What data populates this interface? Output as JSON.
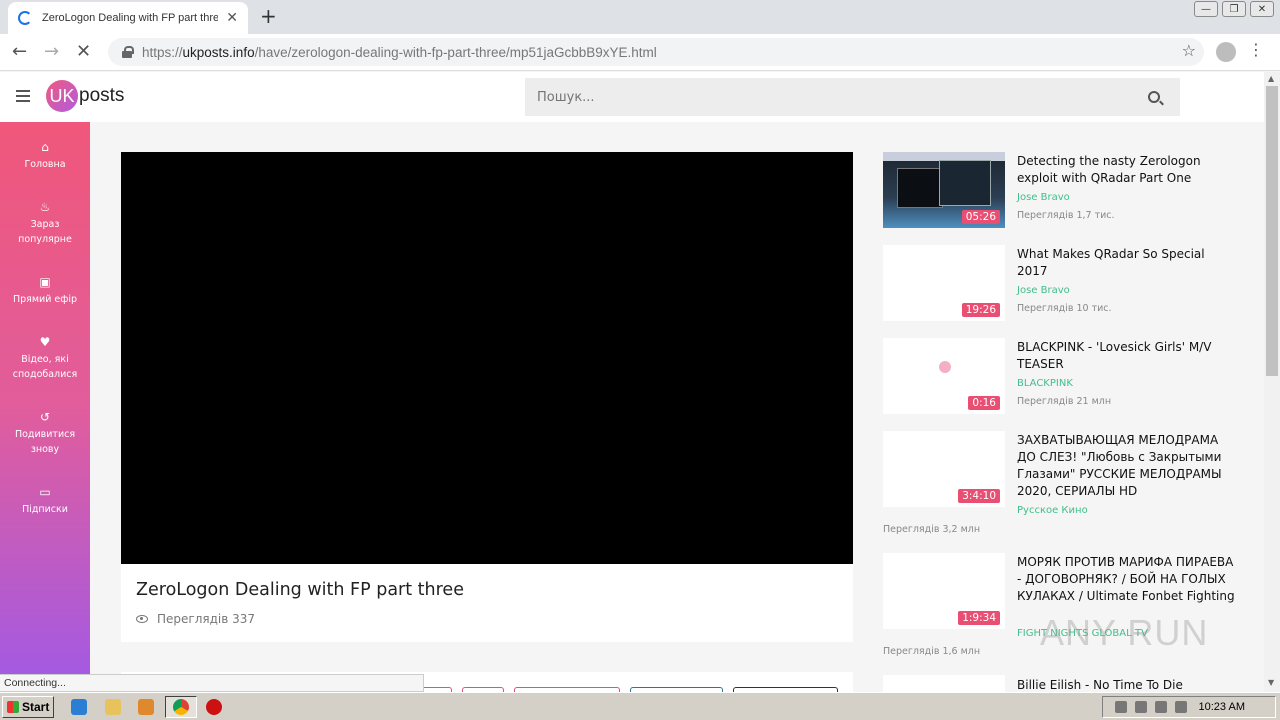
{
  "browser": {
    "tab_title": "ZeroLogon Dealing with FP part three",
    "url_scheme": "https://",
    "url_host": "ukposts.info",
    "url_path": "/have/zerologon-dealing-with-fp-part-three/mp51jaGcbbB9xYE.html",
    "status_text": "Connecting..."
  },
  "site": {
    "logo_badge": "UK",
    "logo_text": "posts",
    "search_placeholder": "Пошук..."
  },
  "sidebar": {
    "items": [
      {
        "label": "Головна",
        "icon": "home-icon"
      },
      {
        "label": "Зараз популярне",
        "icon": "flame-icon"
      },
      {
        "label": "Прямий ефір",
        "icon": "live-icon"
      },
      {
        "label": "Відео, які сподобалися",
        "icon": "heart-icon"
      },
      {
        "label": "Подивитися знову",
        "icon": "history-icon"
      },
      {
        "label": "Підписки",
        "icon": "folder-icon"
      }
    ]
  },
  "video": {
    "title": "ZeroLogon Dealing with FP part three",
    "views": "Переглядів 337"
  },
  "recommendations": [
    {
      "title": "Detecting the nasty Zerologon exploit with QRadar Part One",
      "channel": "Jose Bravo",
      "views": "Переглядів 1,7 тис.",
      "duration": "05:26"
    },
    {
      "title": "What Makes QRadar So Special 2017",
      "channel": "Jose Bravo",
      "views": "Переглядів 10 тис.",
      "duration": "19:26"
    },
    {
      "title": "BLACKPINK - 'Lovesick Girls' M/V TEASER",
      "channel": "BLACKPINK",
      "views": "Переглядів 21 млн",
      "duration": "0:16"
    },
    {
      "title": "ЗАХВАТЫВАЮЩАЯ МЕЛОДРАМА ДО СЛЕЗ! \"Любовь с Закрытыми Глазами\" РУССКИЕ МЕЛОДРАМЫ 2020, СЕРИАЛЫ HD",
      "channel": "Русское Кино",
      "views": "Переглядів 3,2 млн",
      "duration": "3:4:10"
    },
    {
      "title": "МОРЯК ПРОТИВ МАРИФА ПИРАЕВА - ДОГОВОРНЯК? / БОЙ НА ГОЛЫХ КУЛАКАХ / Ultimate Fonbet Fighting",
      "channel": "FIGHT NIGHTS GLOBAL TV",
      "views": "Переглядів 1,6 млн",
      "duration": "1:9:34"
    },
    {
      "title": "Billie Eilish - No Time To Die"
    }
  ],
  "watermark": "ANY RUN",
  "taskbar": {
    "start_label": "Start",
    "clock": "10:23 AM"
  },
  "colors": {
    "accent_pink": "#e94f73",
    "channel_green": "#3fbf8a",
    "sidebar_top": "#f0577a",
    "sidebar_bottom": "#a05ae6"
  }
}
